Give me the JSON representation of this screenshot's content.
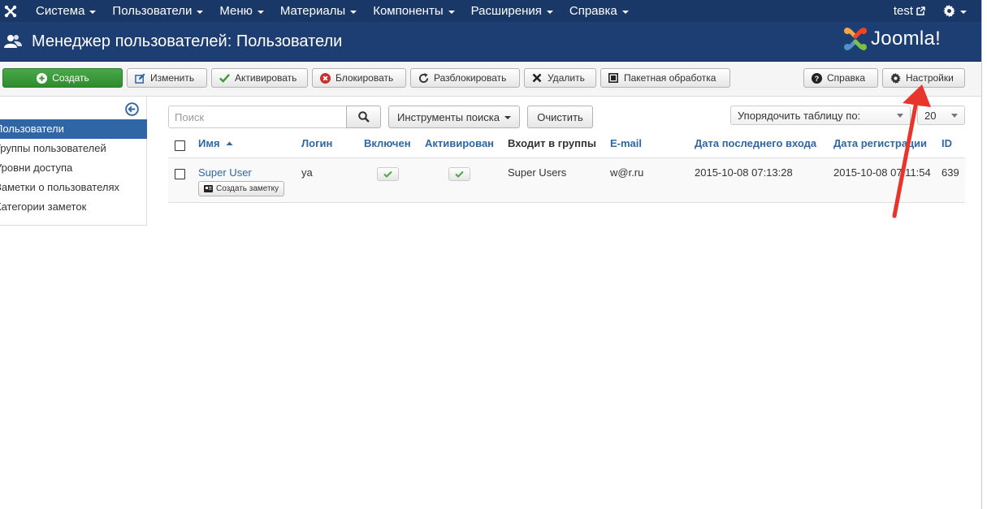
{
  "navbar": {
    "menu": [
      "Система",
      "Пользователи",
      "Меню",
      "Материалы",
      "Компоненты",
      "Расширения",
      "Справка"
    ],
    "user": "test"
  },
  "header": {
    "title": "Менеджер пользователей: Пользователи",
    "logo_text": "Joomla!"
  },
  "toolbar": {
    "create": "Создать",
    "edit": "Изменить",
    "activate": "Активировать",
    "block": "Блокировать",
    "unblock": "Разблокировать",
    "delete": "Удалить",
    "batch": "Пакетная обработка",
    "help": "Справка",
    "options": "Настройки"
  },
  "sidebar": {
    "items": [
      {
        "label": "Пользователи",
        "active": true
      },
      {
        "label": "Группы пользователей",
        "active": false
      },
      {
        "label": "Уровни доступа",
        "active": false
      },
      {
        "label": "Заметки о пользователях",
        "active": false
      },
      {
        "label": "Категории заметок",
        "active": false
      }
    ]
  },
  "filters": {
    "search_placeholder": "Поиск",
    "search_tools": "Инструменты поиска",
    "clear": "Очистить",
    "sort_by": "Упорядочить таблицу по:",
    "limit": "20"
  },
  "table": {
    "columns": {
      "name": "Имя",
      "login": "Логин",
      "enabled": "Включен",
      "activated": "Активирован",
      "groups": "Входит в группы",
      "email": "E-mail",
      "last_visit": "Дата последнего входа",
      "registered": "Дата регистрации",
      "id": "ID"
    },
    "rows": [
      {
        "name": "Super User",
        "login": "ya",
        "enabled": true,
        "activated": true,
        "groups": "Super Users",
        "email": "w@r.ru",
        "last_visit": "2015-10-08 07:13:28",
        "registered": "2015-10-08 07:11:54",
        "id": "639",
        "note_button": "Создать заметку"
      }
    ]
  },
  "colors": {
    "navbar": "#1a3867",
    "header": "#1d3e72",
    "accent": "#2f66a6",
    "success": "#3a9a3a",
    "annotation_arrow": "#e8342a"
  }
}
